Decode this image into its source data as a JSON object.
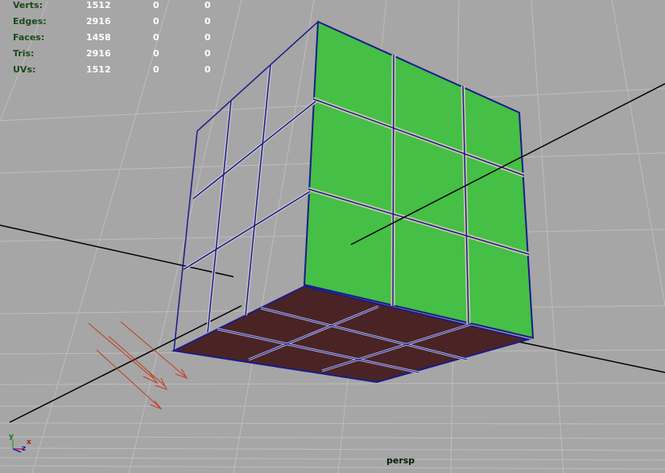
{
  "hud": {
    "rows": [
      {
        "label": "Verts:",
        "values": [
          "1512",
          "0",
          "0"
        ]
      },
      {
        "label": "Edges:",
        "values": [
          "2916",
          "0",
          "0"
        ]
      },
      {
        "label": "Faces:",
        "values": [
          "1458",
          "0",
          "0"
        ]
      },
      {
        "label": "Tris:",
        "values": [
          "2916",
          "0",
          "0"
        ]
      },
      {
        "label": "UVs:",
        "values": [
          "1512",
          "0",
          "0"
        ]
      }
    ]
  },
  "camera": {
    "label": "persp"
  },
  "axes": {
    "x": "x",
    "y": "y",
    "z": "z"
  },
  "colors": {
    "background": "#a6a6a6",
    "grid": "#bdbdbd",
    "face_green": "#45bf45",
    "face_brown": "#4a2424",
    "wire_blue": "#1a1a8c",
    "light_red": "#c03c22"
  }
}
